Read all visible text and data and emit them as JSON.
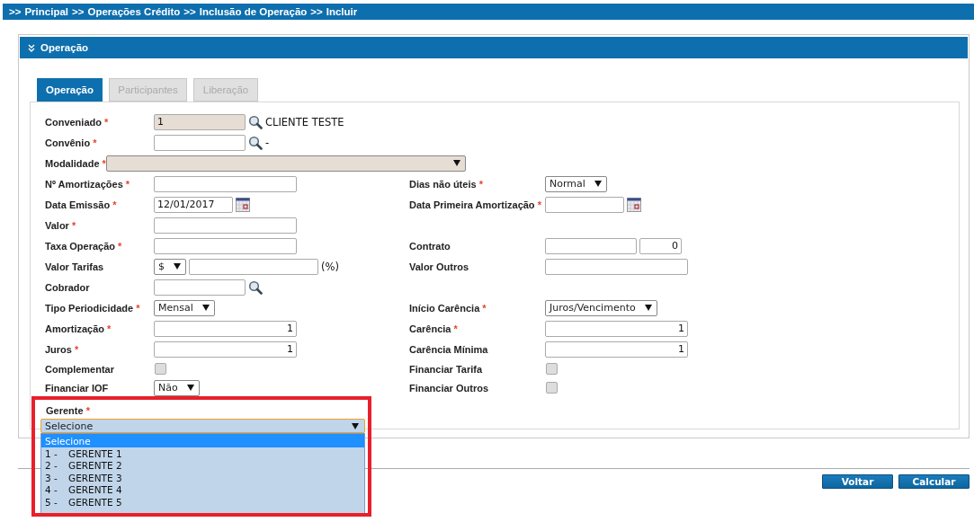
{
  "breadcrumb": {
    "separator": ">>",
    "items": [
      "Principal",
      "Operações Crédito",
      "Inclusão de Operação",
      "Incluir"
    ]
  },
  "panel": {
    "title": "Operação"
  },
  "tabs": [
    {
      "label": "Operação",
      "selected": true,
      "disabled": false
    },
    {
      "label": "Participantes",
      "selected": false,
      "disabled": true
    },
    {
      "label": "Liberação",
      "selected": false,
      "disabled": true
    }
  ],
  "rows": [
    {
      "left": {
        "label": "Conveniado",
        "required": true,
        "controls": [
          {
            "kind": "code_field",
            "value": "1",
            "disabled": true
          },
          {
            "kind": "search_button"
          },
          {
            "kind": "note",
            "text": "CLIENTE TESTE"
          }
        ]
      },
      "right": null
    },
    {
      "left": {
        "label": "Convênio",
        "required": true,
        "controls": [
          {
            "kind": "code_field",
            "disabled": false
          },
          {
            "kind": "search_button"
          },
          {
            "kind": "note",
            "text": "-"
          }
        ]
      },
      "right": null
    },
    {
      "left": {
        "label": "Modalidade",
        "required": true,
        "controls": [
          {
            "kind": "wide_select",
            "disabled": true
          }
        ]
      },
      "right": null
    },
    {
      "left": {
        "label": "Nº Amortizações",
        "required": true,
        "controls": [
          {
            "kind": "field",
            "disabled": false
          }
        ]
      },
      "right": {
        "label": "Dias não úteis",
        "required": true,
        "controls": [
          {
            "kind": "select",
            "value": "Normal",
            "disabled": false
          }
        ]
      }
    },
    {
      "left": {
        "label": "Data Emissão",
        "required": true,
        "controls": [
          {
            "kind": "date_field",
            "value": "12/01/2017",
            "disabled": false
          },
          {
            "kind": "calendar_button"
          }
        ]
      },
      "right": {
        "label": "Data Primeira Amortização",
        "required": true,
        "controls": [
          {
            "kind": "date_field",
            "disabled": false
          },
          {
            "kind": "calendar_button"
          }
        ]
      }
    },
    {
      "left": {
        "label": "Valor",
        "required": true,
        "controls": [
          {
            "kind": "field",
            "disabled": false
          }
        ]
      },
      "right": null
    },
    {
      "left": {
        "label": "Taxa Operação",
        "required": true,
        "controls": [
          {
            "kind": "field",
            "disabled": false
          }
        ]
      },
      "right": {
        "label": "Contrato",
        "required": false,
        "controls": [
          {
            "kind": "code_field",
            "disabled": false
          },
          {
            "kind": "counter_field",
            "value": "0",
            "disabled": false
          }
        ]
      }
    },
    {
      "left": {
        "label": "Valor Tarifas",
        "required": false,
        "controls": [
          {
            "kind": "select",
            "value": "$",
            "disabled": false
          },
          {
            "kind": "rate_field",
            "disabled": false
          },
          {
            "kind": "note",
            "text": "(%)"
          }
        ]
      },
      "right": {
        "label": "Valor Outros",
        "required": false,
        "controls": [
          {
            "kind": "field",
            "disabled": false
          }
        ]
      }
    },
    {
      "left": {
        "label": "Cobrador",
        "required": false,
        "controls": [
          {
            "kind": "code_field",
            "disabled": false
          },
          {
            "kind": "search_button"
          }
        ]
      },
      "right": null
    },
    {
      "left": {
        "label": "Tipo Periodicidade",
        "required": true,
        "controls": [
          {
            "kind": "select",
            "value": "Mensal",
            "disabled": false
          }
        ]
      },
      "right": {
        "label": "Início Carência",
        "required": true,
        "controls": [
          {
            "kind": "select",
            "value": "Juros/Vencimento",
            "disabled": false
          }
        ]
      }
    },
    {
      "left": {
        "label": "Amortização",
        "required": true,
        "controls": [
          {
            "kind": "number_field",
            "value": "1",
            "disabled": false
          }
        ]
      },
      "right": {
        "label": "Carência",
        "required": true,
        "controls": [
          {
            "kind": "number_field",
            "value": "1",
            "disabled": false
          }
        ]
      }
    },
    {
      "left": {
        "label": "Juros",
        "required": true,
        "controls": [
          {
            "kind": "number_field",
            "value": "1",
            "disabled": false
          }
        ]
      },
      "right": {
        "label": "Carência Mínima",
        "required": false,
        "controls": [
          {
            "kind": "number_field",
            "value": "1",
            "disabled": false
          }
        ]
      }
    },
    {
      "left": {
        "label": "Complementar",
        "required": false,
        "controls": [
          {
            "kind": "checkbox",
            "checked": false
          }
        ]
      },
      "right": {
        "label": "Financiar Tarifa",
        "required": false,
        "controls": [
          {
            "kind": "checkbox",
            "checked": false
          }
        ]
      }
    },
    {
      "left": {
        "label": "Financiar IOF",
        "required": false,
        "controls": [
          {
            "kind": "select",
            "value": "Não",
            "disabled": false
          }
        ]
      },
      "right": {
        "label": "Financiar Outros",
        "required": false,
        "controls": [
          {
            "kind": "checkbox",
            "checked": false
          }
        ]
      }
    }
  ],
  "gerente": {
    "label": "Gerente",
    "required": true,
    "value": "Selecione",
    "expanded": true,
    "options": [
      {
        "name": "Selecione",
        "selected": true
      },
      {
        "number": "1 -",
        "name": "GERENTE 1",
        "selected": false
      },
      {
        "number": "2 -",
        "name": "GERENTE 2",
        "selected": false
      },
      {
        "number": "3 -",
        "name": "GERENTE 3",
        "selected": false
      },
      {
        "number": "4 -",
        "name": "GERENTE 4",
        "selected": false
      },
      {
        "number": "5 -",
        "name": "GERENTE 5",
        "selected": false
      }
    ]
  },
  "required_mark": "*",
  "buttons": [
    "Voltar",
    "Calcular"
  ]
}
